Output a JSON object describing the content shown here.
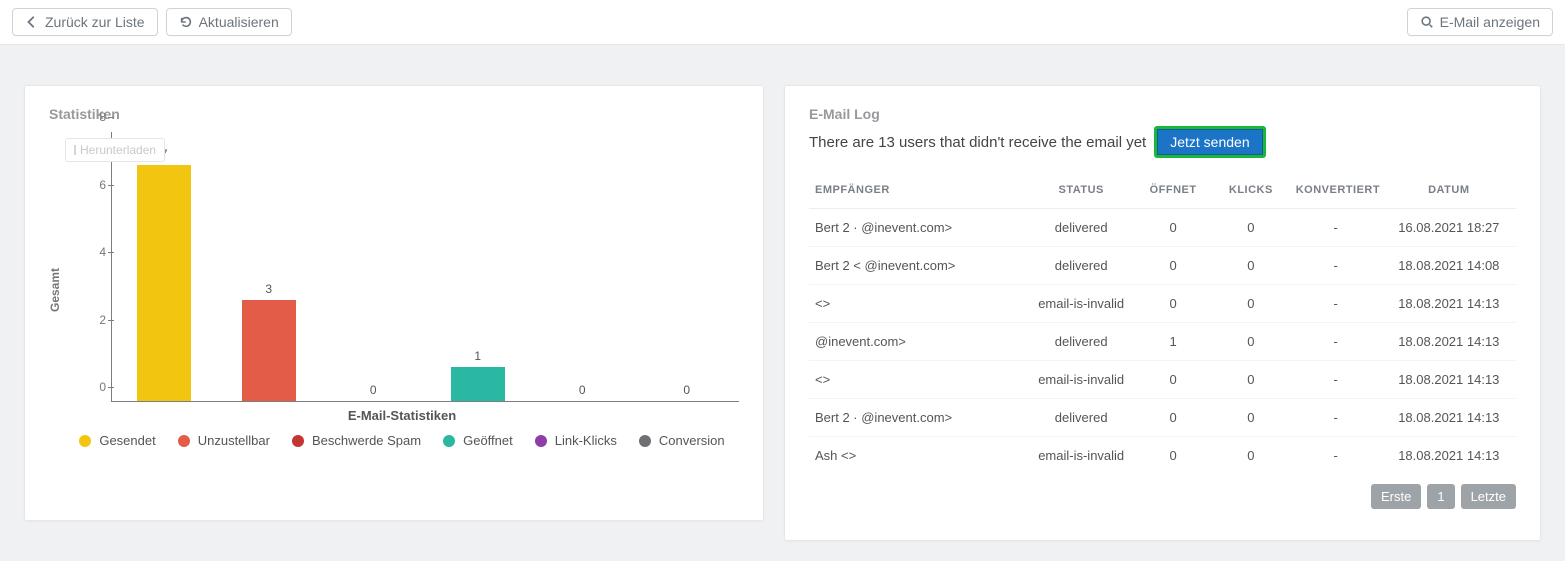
{
  "topbar": {
    "back_label": "Zurück zur Liste",
    "refresh_label": "Aktualisieren",
    "view_email_label": "E-Mail anzeigen"
  },
  "stats": {
    "title": "Statistiken",
    "download_label": "Herunterladen"
  },
  "chart_data": {
    "type": "bar",
    "title": "E-Mail-Statistiken",
    "ylabel": "Gesamt",
    "ylim": [
      0,
      8
    ],
    "yticks": [
      0,
      2,
      4,
      6,
      8
    ],
    "categories": [
      "Gesendet",
      "Unzustellbar",
      "Beschwerde Spam",
      "Geöffnet",
      "Link-Klicks",
      "Conversion"
    ],
    "values": [
      7,
      3,
      0,
      1,
      0,
      0
    ],
    "colors": [
      "#f2c511",
      "#e25c48",
      "#c23531",
      "#2ab8a2",
      "#8e3ea8",
      "#6f7074"
    ]
  },
  "log": {
    "title": "E-Mail Log",
    "subtext": "There are 13 users that didn't receive the email yet",
    "send_label": "Jetzt senden",
    "columns": {
      "recipient": "EMPFÄNGER",
      "status": "STATUS",
      "opens": "ÖFFNET",
      "clicks": "KLICKS",
      "converts": "KONVERTIERT",
      "date": "DATUM"
    },
    "rows": [
      {
        "recipient": "Bert 2 ·      @inevent.com>",
        "status": "delivered",
        "opens": "0",
        "clicks": "0",
        "conv": "-",
        "date": "16.08.2021 18:27"
      },
      {
        "recipient": "Bert 2 <      @inevent.com>",
        "status": "delivered",
        "opens": "0",
        "clicks": "0",
        "conv": "-",
        "date": "18.08.2021 14:08"
      },
      {
        "recipient": "            <>",
        "status": "email-is-invalid",
        "opens": "0",
        "clicks": "0",
        "conv": "-",
        "date": "18.08.2021 14:13"
      },
      {
        "recipient": "               @inevent.com>",
        "status": "delivered",
        "opens": "1",
        "clicks": "0",
        "conv": "-",
        "date": "18.08.2021 14:13"
      },
      {
        "recipient": "<>",
        "status": "email-is-invalid",
        "opens": "0",
        "clicks": "0",
        "conv": "-",
        "date": "18.08.2021 14:13"
      },
      {
        "recipient": "Bert 2 ·      @inevent.com>",
        "status": "delivered",
        "opens": "0",
        "clicks": "0",
        "conv": "-",
        "date": "18.08.2021 14:13"
      },
      {
        "recipient": "Ash <>",
        "status": "email-is-invalid",
        "opens": "0",
        "clicks": "0",
        "conv": "-",
        "date": "18.08.2021 14:13"
      }
    ],
    "pager": {
      "first": "Erste",
      "page": "1",
      "last": "Letzte"
    }
  }
}
